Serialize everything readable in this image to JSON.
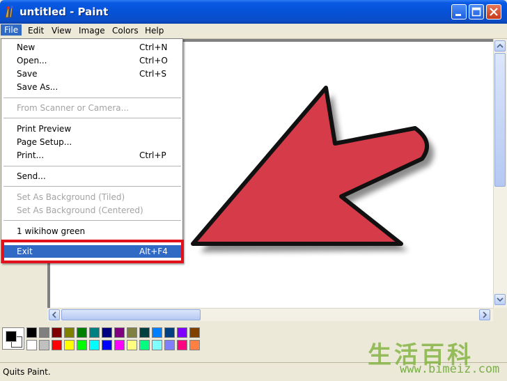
{
  "window": {
    "title": "untitled - Paint"
  },
  "menubar": {
    "items": [
      "File",
      "Edit",
      "View",
      "Image",
      "Colors",
      "Help"
    ]
  },
  "file_menu": {
    "items": [
      {
        "label": "New",
        "shortcut": "Ctrl+N",
        "disabled": false
      },
      {
        "label": "Open...",
        "shortcut": "Ctrl+O",
        "disabled": false
      },
      {
        "label": "Save",
        "shortcut": "Ctrl+S",
        "disabled": false
      },
      {
        "label": "Save As...",
        "shortcut": "",
        "disabled": false
      },
      {
        "label": "From Scanner or Camera...",
        "shortcut": "",
        "disabled": true
      },
      {
        "label": "Print Preview",
        "shortcut": "",
        "disabled": false
      },
      {
        "label": "Page Setup...",
        "shortcut": "",
        "disabled": false
      },
      {
        "label": "Print...",
        "shortcut": "Ctrl+P",
        "disabled": false
      },
      {
        "label": "Send...",
        "shortcut": "",
        "disabled": false
      },
      {
        "label": "Set As Background (Tiled)",
        "shortcut": "",
        "disabled": true
      },
      {
        "label": "Set As Background (Centered)",
        "shortcut": "",
        "disabled": true
      },
      {
        "label": "1 wikihow green",
        "shortcut": "",
        "disabled": false
      },
      {
        "label": "Exit",
        "shortcut": "Alt+F4",
        "disabled": false,
        "selected": true
      }
    ]
  },
  "canvas": {
    "arrow_fill": "#D63B4A",
    "arrow_stroke": "#111111"
  },
  "palette": {
    "top_row": [
      "#000000",
      "#808080",
      "#800000",
      "#808000",
      "#008000",
      "#008080",
      "#000080",
      "#800080",
      "#808040",
      "#004040",
      "#0080FF",
      "#004080",
      "#8000FF",
      "#804000"
    ],
    "bottom_row": [
      "#FFFFFF",
      "#C0C0C0",
      "#FF0000",
      "#FFFF00",
      "#00FF00",
      "#00FFFF",
      "#0000FF",
      "#FF00FF",
      "#FFFF80",
      "#00FF80",
      "#80FFFF",
      "#8080FF",
      "#FF0080",
      "#FF8040"
    ],
    "foreground": "#000000",
    "background": "#FFFFFF"
  },
  "status": {
    "text": "Quits Paint."
  },
  "watermark": {
    "chars": "生活百科",
    "url": "www.bimeiz.com"
  },
  "colors": {
    "highlight": "#E1121B",
    "menu_selection": "#316AC5",
    "titlebar": "#0552D8"
  }
}
